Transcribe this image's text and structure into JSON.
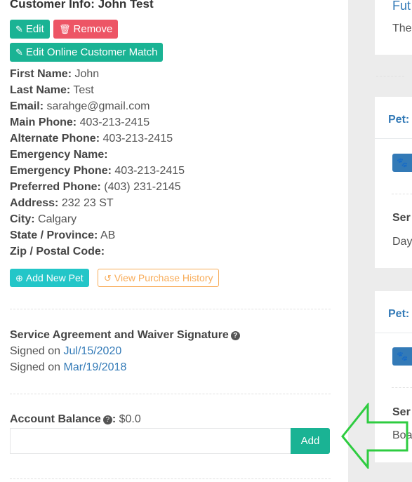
{
  "customer": {
    "title": "Customer Info: John Test",
    "buttons": {
      "edit": "Edit",
      "remove": "Remove",
      "edit_online_match": "Edit Online Customer Match",
      "add_new_pet": "Add New Pet",
      "view_purchase_history": "View Purchase History"
    },
    "fields": [
      {
        "label": "First Name:",
        "value": "John"
      },
      {
        "label": "Last Name:",
        "value": "Test"
      },
      {
        "label": "Email:",
        "value": "sarahge@gmail.com"
      },
      {
        "label": "Main Phone:",
        "value": "403-213-2415"
      },
      {
        "label": "Alternate Phone:",
        "value": "403-213-2415"
      },
      {
        "label": "Emergency Name:",
        "value": ""
      },
      {
        "label": "Emergency Phone:",
        "value": "403-213-2415"
      },
      {
        "label": "Preferred Phone:",
        "value": "(403) 231-2145"
      },
      {
        "label": "Address:",
        "value": "232 23 ST"
      },
      {
        "label": "City:",
        "value": "Calgary"
      },
      {
        "label": "State / Province:",
        "value": "AB"
      },
      {
        "label": "Zip / Postal Code:",
        "value": ""
      }
    ]
  },
  "waiver": {
    "title": "Service Agreement and Waiver Signature",
    "signed_prefix": "Signed on",
    "dates": [
      "Jul/15/2020",
      "Mar/19/2018"
    ]
  },
  "balance": {
    "label": "Account Balance",
    "value": "$0.0",
    "input_value": "",
    "add_label": "Add"
  },
  "right_column": {
    "future_header": "Fut",
    "future_text": "The",
    "pets": [
      {
        "header": "Pet:",
        "service_label": "Ser",
        "service_text": "Day"
      },
      {
        "header": "Pet:",
        "service_label": "Ser",
        "service_text": "Boa"
      }
    ]
  },
  "colors": {
    "primary": "#1ab394",
    "danger": "#ed5565",
    "info": "#23c6c8",
    "warning": "#f8ac59",
    "link": "#337ab7",
    "annotation_arrow": "#2ecc40"
  }
}
